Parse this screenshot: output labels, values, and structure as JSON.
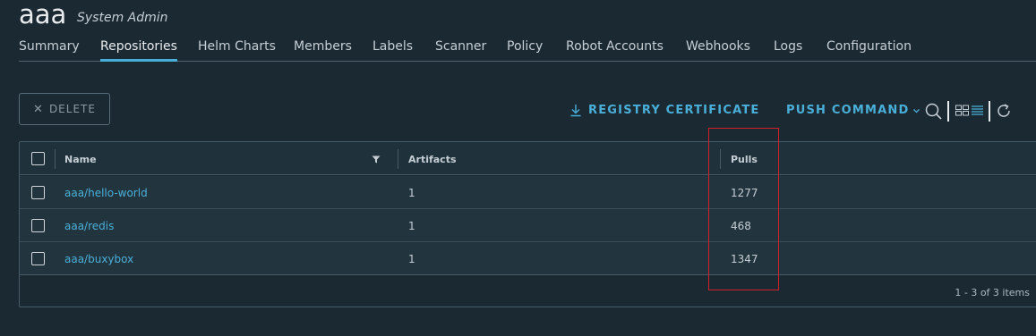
{
  "project": {
    "name": "aaa",
    "role": "System Admin"
  },
  "tabs": [
    {
      "label": "Summary",
      "active": false
    },
    {
      "label": "Repositories",
      "active": true
    },
    {
      "label": "Helm Charts",
      "active": false
    },
    {
      "label": "Members",
      "active": false
    },
    {
      "label": "Labels",
      "active": false
    },
    {
      "label": "Scanner",
      "active": false
    },
    {
      "label": "Policy",
      "active": false
    },
    {
      "label": "Robot Accounts",
      "active": false
    },
    {
      "label": "Webhooks",
      "active": false
    },
    {
      "label": "Logs",
      "active": false
    },
    {
      "label": "Configuration",
      "active": false
    }
  ],
  "toolbar": {
    "delete_label": "DELETE",
    "registry_certificate_label": "REGISTRY CERTIFICATE",
    "push_command_label": "PUSH COMMAND",
    "icons": [
      "download-icon",
      "chevron-down-icon",
      "search-icon",
      "card-view-icon",
      "list-view-icon",
      "refresh-icon"
    ]
  },
  "table": {
    "columns": [
      "Name",
      "Artifacts",
      "Pulls"
    ],
    "rows": [
      {
        "name": "aaa/hello-world",
        "artifacts": "1",
        "pulls": "1277"
      },
      {
        "name": "aaa/redis",
        "artifacts": "1",
        "pulls": "468"
      },
      {
        "name": "aaa/buxybox",
        "artifacts": "1",
        "pulls": "1347"
      }
    ],
    "footer": "1 - 3 of 3 items"
  },
  "colors": {
    "background": "#1b2a32",
    "accent": "#49afd9",
    "highlight": "#d0202a"
  }
}
